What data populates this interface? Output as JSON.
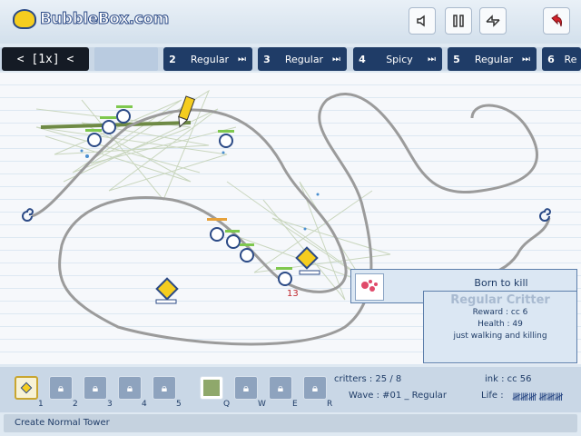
{
  "header": {
    "logo_text": "BubbleBox.com",
    "controls": [
      {
        "name": "sound-toggle-button",
        "icon": "speaker-icon"
      },
      {
        "name": "pause-button",
        "icon": "pause-icon"
      },
      {
        "name": "restart-button",
        "icon": "refresh-icon"
      },
      {
        "name": "quit-button",
        "icon": "back-arrow-icon"
      }
    ]
  },
  "speed": {
    "label": "<  [1x]  <"
  },
  "waves": [
    {
      "number": "2",
      "name": "Regular"
    },
    {
      "number": "3",
      "name": "Regular"
    },
    {
      "number": "4",
      "name": "Spicy"
    },
    {
      "number": "5",
      "name": "Regular"
    },
    {
      "number": "6",
      "name": "Re"
    }
  ],
  "field": {
    "critter_counter": "13"
  },
  "info_panel": {
    "born_label": "Born to kill",
    "title": "Regular Critter",
    "reward": "Reward : cc 6",
    "health": "Health : 49",
    "description": "just walking and killing"
  },
  "toolbar": {
    "towers": [
      {
        "key": "1",
        "state": "selected"
      },
      {
        "key": "2",
        "state": "locked"
      },
      {
        "key": "3",
        "state": "locked"
      },
      {
        "key": "4",
        "state": "locked"
      },
      {
        "key": "5",
        "state": "locked"
      }
    ],
    "abilities": [
      {
        "key": "Q",
        "state": "available"
      },
      {
        "key": "W",
        "state": "locked"
      },
      {
        "key": "E",
        "state": "locked"
      },
      {
        "key": "R",
        "state": "locked"
      }
    ],
    "critters_label": "critters : 25 / 8",
    "wave_label": "Wave : #01 _ Regular",
    "ink_label": "ink : cc 56",
    "life_label": "Life :",
    "life_tally": "𝍸𝍸𝍸 𝍸𝍸𝍸"
  },
  "status_bar": {
    "text": "Create Normal Tower"
  },
  "colors": {
    "wave_bg": "#1f3c67",
    "accent_yellow": "#f5cd1f",
    "path_gray": "#9b9b9b"
  }
}
